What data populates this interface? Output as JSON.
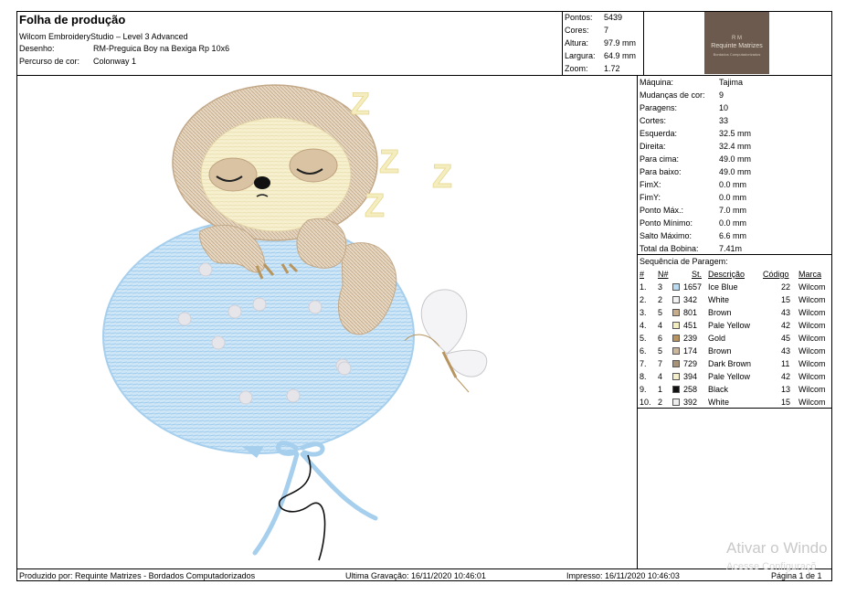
{
  "header": {
    "title": "Folha de produção",
    "software": "Wilcom EmbroideryStudio – Level 3 Advanced",
    "design_label": "Desenho:",
    "design_value": "RM-Preguica Boy na Bexiga Rp 10x6",
    "colorway_label": "Percurso de cor:",
    "colorway_value": "Colonway 1"
  },
  "summary": [
    {
      "label": "Pontos:",
      "value": "5439"
    },
    {
      "label": "Cores:",
      "value": "7"
    },
    {
      "label": "Altura:",
      "value": "97.9 mm"
    },
    {
      "label": "Largura:",
      "value": "64.9 mm"
    },
    {
      "label": "Zoom:",
      "value": "1.72"
    }
  ],
  "logo": {
    "line1": "R M",
    "line2": "Requinte Matrizes",
    "line3": "Bordados Computadorizados"
  },
  "machine_stats": [
    {
      "label": "Máquina:",
      "value": "Tajima"
    },
    {
      "label": "Mudanças de cor:",
      "value": "9"
    },
    {
      "label": "Paragens:",
      "value": "10"
    },
    {
      "label": "Cortes:",
      "value": "33"
    },
    {
      "label": "Esquerda:",
      "value": "32.5 mm"
    },
    {
      "label": "Direita:",
      "value": "32.4 mm"
    },
    {
      "label": "Para cima:",
      "value": "49.0 mm"
    },
    {
      "label": "Para baixo:",
      "value": "49.0 mm"
    },
    {
      "label": "FimX:",
      "value": "0.0 mm"
    },
    {
      "label": "FimY:",
      "value": "0.0 mm"
    },
    {
      "label": "Ponto Máx.:",
      "value": "7.0 mm"
    },
    {
      "label": "Ponto Mínimo:",
      "value": "0.0 mm"
    },
    {
      "label": "Salto Máximo:",
      "value": "6.6 mm"
    },
    {
      "label": "Total da Bobina:",
      "value": "7.41m"
    }
  ],
  "sequence": {
    "title": "Sequência de Paragem:",
    "headers": {
      "num": "#",
      "n": "N#",
      "st": "St.",
      "desc": "Descrição",
      "code": "Código",
      "brand": "Marca"
    },
    "rows": [
      {
        "num": "1.",
        "n": "3",
        "st": "1657",
        "desc": "Ice Blue",
        "code": "22",
        "brand": "Wilcom",
        "color": "#b9dcf2"
      },
      {
        "num": "2.",
        "n": "2",
        "st": "342",
        "desc": "White",
        "code": "15",
        "brand": "Wilcom",
        "color": "#f2f2f2"
      },
      {
        "num": "3.",
        "n": "5",
        "st": "801",
        "desc": "Brown",
        "code": "43",
        "brand": "Wilcom",
        "color": "#c8ad8c"
      },
      {
        "num": "4.",
        "n": "4",
        "st": "451",
        "desc": "Pale Yellow",
        "code": "42",
        "brand": "Wilcom",
        "color": "#f4edc0"
      },
      {
        "num": "5.",
        "n": "6",
        "st": "239",
        "desc": "Gold",
        "code": "45",
        "brand": "Wilcom",
        "color": "#b8955e"
      },
      {
        "num": "6.",
        "n": "5",
        "st": "174",
        "desc": "Brown",
        "code": "43",
        "brand": "Wilcom",
        "color": "#cbb79e"
      },
      {
        "num": "7.",
        "n": "7",
        "st": "729",
        "desc": "Dark Brown",
        "code": "11",
        "brand": "Wilcom",
        "color": "#a89278"
      },
      {
        "num": "8.",
        "n": "4",
        "st": "394",
        "desc": "Pale Yellow",
        "code": "42",
        "brand": "Wilcom",
        "color": "#f6efcb"
      },
      {
        "num": "9.",
        "n": "1",
        "st": "258",
        "desc": "Black",
        "code": "13",
        "brand": "Wilcom",
        "color": "#111111"
      },
      {
        "num": "10.",
        "n": "2",
        "st": "392",
        "desc": "White",
        "code": "15",
        "brand": "Wilcom",
        "color": "#eeeeee"
      }
    ]
  },
  "footer": {
    "produced_by": "Produzido por: Requinte Matrizes - Bordados Computadorizados",
    "last_saved": "Ultima Gravação: 16/11/2020 10:46:01",
    "printed": "Impresso: 16/11/2020 10:46:03",
    "page": "Página 1 de 1"
  },
  "watermark": {
    "line1": "Ativar o Windo",
    "line2": "Acesse Configuraçõ"
  },
  "design_letters": [
    "Z",
    "Z",
    "Z",
    "Z"
  ]
}
